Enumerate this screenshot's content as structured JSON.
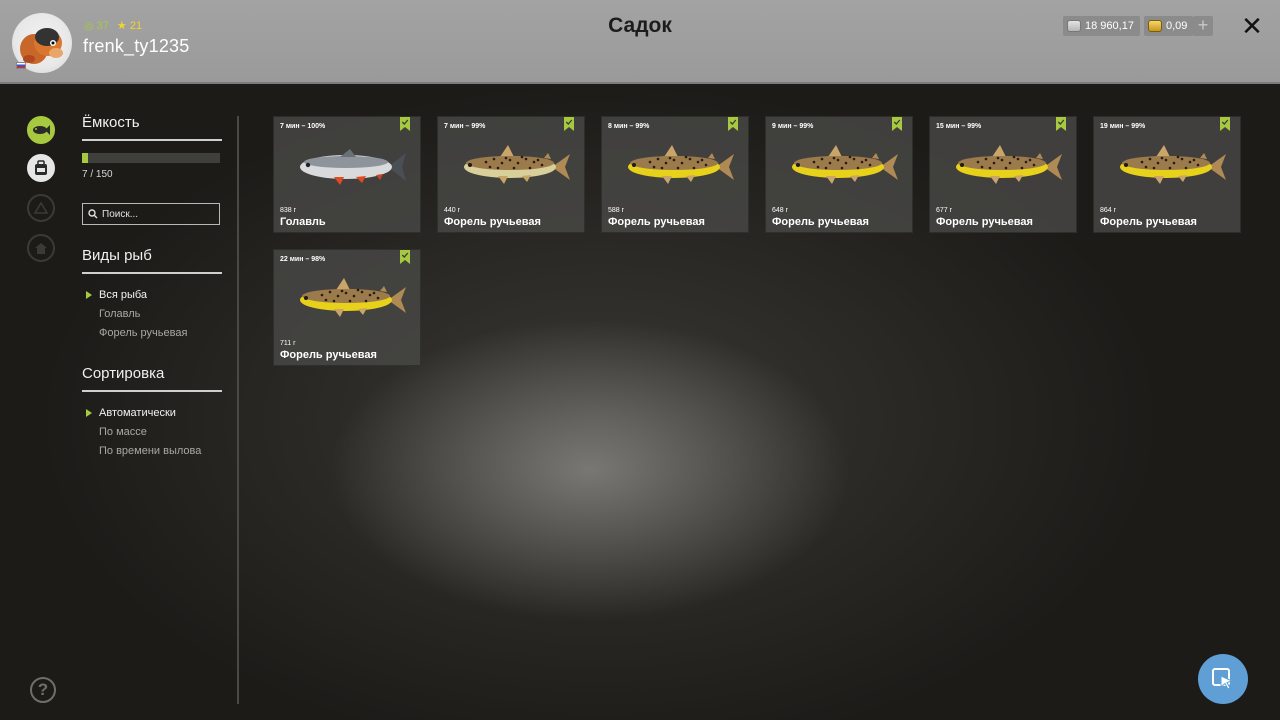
{
  "header": {
    "title": "Садок",
    "user": {
      "name": "frenk_ty1235",
      "level": "37",
      "rank": "21"
    },
    "currency": {
      "silver": "18 960,17",
      "gold": "0,09",
      "add_label": "+"
    },
    "close_label": "✕"
  },
  "left_icons": [
    "fish-icon",
    "backpack-icon",
    "camp-icon",
    "home-icon",
    "help-icon"
  ],
  "help_label": "?",
  "panel": {
    "capacity": {
      "title": "Ёмкость",
      "text": "7 / 150",
      "fill_fraction": 0.047
    },
    "search": {
      "placeholder": "Поиск..."
    },
    "species": {
      "title": "Виды рыб",
      "items": [
        {
          "label": "Вся рыба",
          "active": true
        },
        {
          "label": "Голавль",
          "active": false
        },
        {
          "label": "Форель ручьевая",
          "active": false
        }
      ]
    },
    "sort": {
      "title": "Сортировка",
      "items": [
        {
          "label": "Автоматически",
          "active": true
        },
        {
          "label": "По массе",
          "active": false
        },
        {
          "label": "По времени вылова",
          "active": false
        }
      ]
    }
  },
  "fish": [
    {
      "catch": "7 мин – 100%",
      "weight": "838 г",
      "name": "Голавль",
      "kind": "chub"
    },
    {
      "catch": "7 мин – 99%",
      "weight": "440 г",
      "name": "Форель ручьевая",
      "kind": "trout-pale"
    },
    {
      "catch": "8 мин – 99%",
      "weight": "588 г",
      "name": "Форель ручьевая",
      "kind": "trout"
    },
    {
      "catch": "9 мин – 99%",
      "weight": "648 г",
      "name": "Форель ручьевая",
      "kind": "trout"
    },
    {
      "catch": "15 мин – 99%",
      "weight": "677 г",
      "name": "Форель ручьевая",
      "kind": "trout"
    },
    {
      "catch": "19 мин – 99%",
      "weight": "864 г",
      "name": "Форель ручьевая",
      "kind": "trout"
    },
    {
      "catch": "22 мин – 98%",
      "weight": "711 г",
      "name": "Форель ручьевая",
      "kind": "trout"
    }
  ],
  "colors": {
    "accent": "#a6c93f",
    "header": "#9e9e9e",
    "cursor_button": "#5f9fd6"
  }
}
